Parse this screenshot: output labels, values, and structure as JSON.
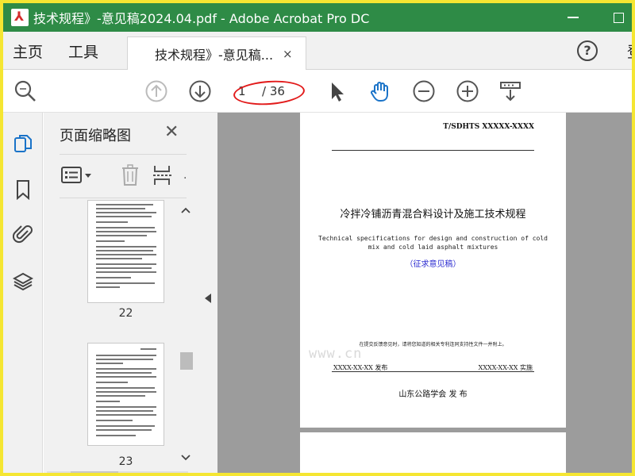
{
  "window": {
    "title": "技术规程》-意见稿2024.04.pdf - Adobe Acrobat Pro DC"
  },
  "tabs": {
    "home_label": "主页",
    "tools_label": "工具",
    "document_tab_label": "技术规程》-意见稿...",
    "close_glyph": "×",
    "help_glyph": "?",
    "signin_clip": "登"
  },
  "toolbar": {
    "current_page": "1",
    "total_pages": "/ 36",
    "icons": [
      "zoom-search-icon",
      "page-up-icon",
      "page-down-icon",
      "select-arrow-icon",
      "hand-tool-icon",
      "zoom-out-icon",
      "zoom-in-icon",
      "scroll-mode-icon"
    ]
  },
  "rail": {
    "icons": [
      "page-thumbnails-icon",
      "bookmark-icon",
      "attachment-icon",
      "layers-icon"
    ],
    "accent": "#1a73c8"
  },
  "thumbnails": {
    "title": "页面缩略图",
    "close_glyph": "✕",
    "pages": [
      {
        "label": "22"
      },
      {
        "label": "23"
      }
    ]
  },
  "document": {
    "standard_code": "T/SDHTS XXXXX-XXXX",
    "title_cn": "冷拌冷铺沥青混合料设计及施工技术规程",
    "title_en_line1": "Technical specifications for design and construction of cold",
    "title_en_line2": "mix and cold laid asphalt mixtures",
    "draft_label": "（征求意见稿）",
    "note": "在提交反馈意见时，请将您知道的相关专利连同支持性文件一并附上。",
    "release_date": "XXXX-XX-XX 发布",
    "implement_date": "XXXX-XX-XX 实施",
    "publisher": "山东公路学会 发 布"
  },
  "watermark": "www.cn",
  "colors": {
    "titlebar": "#2e8b46",
    "frame": "#f5e632",
    "annotation_ring": "#e21b1b",
    "active_hand": "#1a73c8"
  }
}
